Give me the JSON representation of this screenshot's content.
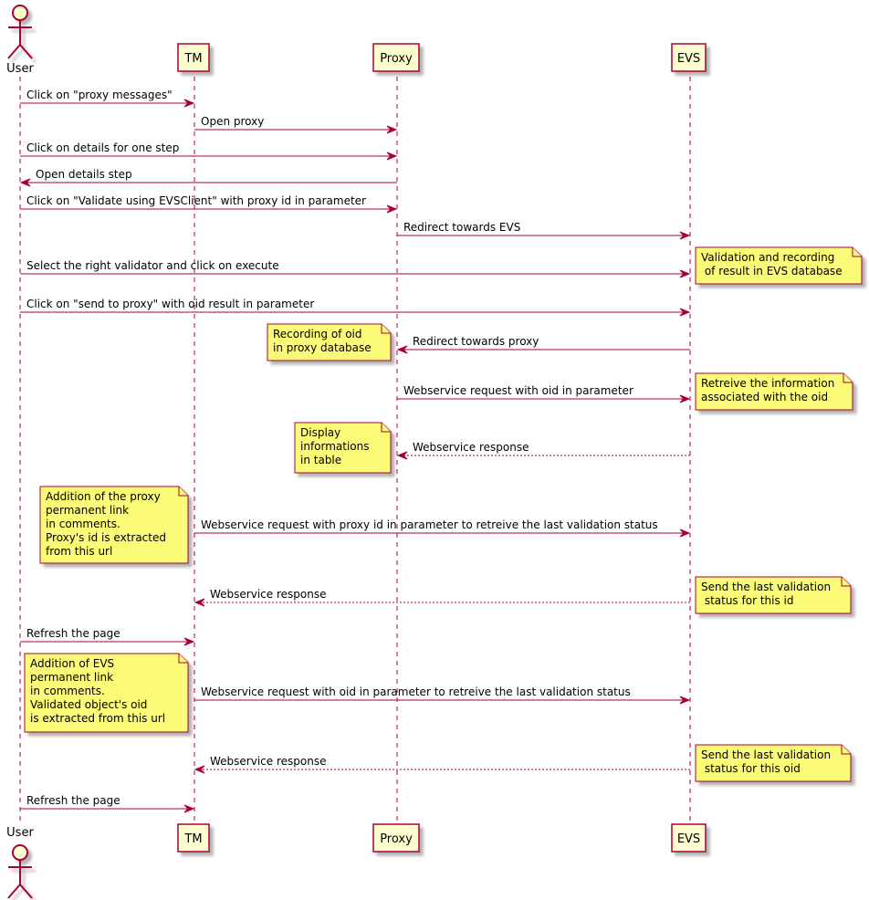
{
  "diagram": {
    "type": "sequence",
    "colors": {
      "line": "#A80036",
      "participant_fill": "#FEFECE",
      "note_fill": "#FBFB77",
      "shadow": "#C9C9C9"
    },
    "participants": [
      {
        "id": "user",
        "label": "User",
        "kind": "actor"
      },
      {
        "id": "tm",
        "label": "TM",
        "kind": "participant"
      },
      {
        "id": "proxy",
        "label": "Proxy",
        "kind": "participant"
      },
      {
        "id": "evs",
        "label": "EVS",
        "kind": "participant"
      }
    ],
    "messages": [
      {
        "from": "user",
        "to": "tm",
        "label": "Click on \"proxy messages\"",
        "style": "solid"
      },
      {
        "from": "tm",
        "to": "proxy",
        "label": "Open proxy",
        "style": "solid"
      },
      {
        "from": "user",
        "to": "proxy",
        "label": "Click on details for one step",
        "style": "solid"
      },
      {
        "from": "proxy",
        "to": "user",
        "label": "Open details step",
        "style": "solid"
      },
      {
        "from": "user",
        "to": "proxy",
        "label": "Click on \"Validate using EVSClient\" with proxy id in parameter",
        "style": "solid"
      },
      {
        "from": "proxy",
        "to": "evs",
        "label": "Redirect towards EVS",
        "style": "solid"
      },
      {
        "from": "user",
        "to": "evs",
        "label": "Select the right validator and click on execute",
        "style": "solid",
        "note": {
          "side": "right",
          "of": "evs",
          "lines": [
            "Validation and recording",
            " of result in EVS database"
          ]
        }
      },
      {
        "from": "user",
        "to": "evs",
        "label": "Click on \"send to proxy\" with oid result in parameter",
        "style": "solid"
      },
      {
        "from": "evs",
        "to": "proxy",
        "label": "Redirect towards proxy",
        "style": "solid",
        "note": {
          "side": "left",
          "of": "proxy",
          "lines": [
            "Recording of oid",
            "in proxy database"
          ]
        }
      },
      {
        "from": "proxy",
        "to": "evs",
        "label": "Webservice request with oid in parameter",
        "style": "solid",
        "note": {
          "side": "right",
          "of": "evs",
          "lines": [
            "Retreive the information",
            "associated with the oid"
          ]
        }
      },
      {
        "from": "evs",
        "to": "proxy",
        "label": "Webservice response",
        "style": "dotted",
        "note": {
          "side": "left",
          "of": "proxy",
          "lines": [
            "Display",
            "informations",
            "in table"
          ]
        }
      },
      {
        "from": "tm",
        "to": "evs",
        "label": "Webservice request with proxy id in parameter to retreive the last validation status",
        "style": "solid",
        "note": {
          "side": "left",
          "of": "tm",
          "lines": [
            "Addition of the proxy",
            "permanent link",
            "in comments.",
            "Proxy's id is extracted",
            "from this url"
          ]
        }
      },
      {
        "from": "evs",
        "to": "tm",
        "label": "Webservice response",
        "style": "dotted",
        "note": {
          "side": "right",
          "of": "evs",
          "lines": [
            "Send the last validation",
            " status for this id"
          ]
        }
      },
      {
        "from": "user",
        "to": "tm",
        "label": "Refresh the page",
        "style": "solid"
      },
      {
        "from": "tm",
        "to": "evs",
        "label": "Webservice request with oid in parameter to retreive the last validation status",
        "style": "solid",
        "note": {
          "side": "left",
          "of": "tm",
          "lines": [
            "Addition of EVS",
            "permanent link",
            "in comments.",
            "Validated object's oid",
            "is extracted from this url"
          ]
        }
      },
      {
        "from": "evs",
        "to": "tm",
        "label": "Webservice response",
        "style": "dotted",
        "note": {
          "side": "right",
          "of": "evs",
          "lines": [
            "Send the last validation",
            " status for this oid"
          ]
        }
      },
      {
        "from": "user",
        "to": "tm",
        "label": "Refresh the page",
        "style": "solid"
      }
    ]
  }
}
